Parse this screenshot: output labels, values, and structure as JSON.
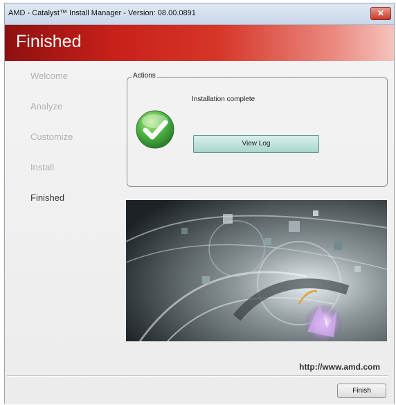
{
  "window": {
    "title": "AMD - Catalyst™ Install Manager - Version: 08.00.0891",
    "close_glyph": "✕"
  },
  "banner": {
    "title": "Finished"
  },
  "steps": [
    {
      "label": "Welcome",
      "active": false
    },
    {
      "label": "Analyze",
      "active": false
    },
    {
      "label": "Customize",
      "active": false
    },
    {
      "label": "Install",
      "active": false
    },
    {
      "label": "Finished",
      "active": true
    }
  ],
  "actions": {
    "legend": "Actions",
    "status": "Installation complete",
    "icon": "checkmark-icon",
    "view_log_label": "View Log"
  },
  "footer": {
    "url": "http://www.amd.com",
    "finish_label": "Finish"
  },
  "colors": {
    "banner_red": "#c8201a",
    "button_teal": "#a9d6cf",
    "check_green": "#3da83b"
  }
}
